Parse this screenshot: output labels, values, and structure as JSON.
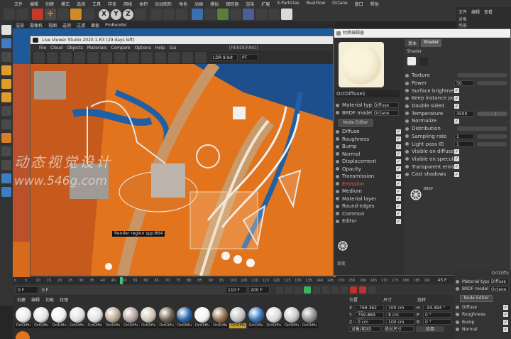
{
  "menubar": {
    "items": [
      "文件",
      "编辑",
      "创建",
      "模式",
      "选择",
      "工具",
      "样条",
      "网格",
      "体积",
      "运动图形",
      "角色",
      "动画",
      "模拟",
      "跟踪器",
      "渲染",
      "扩展",
      "X-Particles",
      "RealFlow",
      "Octane",
      "窗口",
      "帮助"
    ]
  },
  "tabs": {
    "items": [
      "渲染",
      "摄像机",
      "视图",
      "选项",
      "过滤",
      "面板",
      "ProRender"
    ]
  },
  "axes": {
    "x": "X",
    "y": "Y",
    "z": "Z"
  },
  "right_menu": {
    "items": [
      "文件",
      "编辑",
      "查看"
    ]
  },
  "live_viewer": {
    "title": "Live Viewer Studio 2020.1-R3 (29 days left)",
    "menu": [
      "File",
      "Cloud",
      "Objects",
      "Materials",
      "Compare",
      "Options",
      "Help",
      "Gui"
    ],
    "status": "[RENDERING]",
    "ldr": "LDR 8-bit",
    "pt": "PT",
    "render_region": "Render region spp:864"
  },
  "watermark": {
    "cn": "动态视觉设计",
    "url": "www.546g.com"
  },
  "material_editor": {
    "title": "材质编辑器",
    "material_name": "OctDiffuse1",
    "tabs": [
      "基本",
      "Shader"
    ],
    "section": "Shader",
    "left_rows": [
      {
        "label": "Material type",
        "value": "Diffuse"
      },
      {
        "label": "BRDF model",
        "value": "Octane"
      }
    ],
    "node_editor": "Node Editor",
    "channels": [
      "Diffuse",
      "Roughness",
      "Bump",
      "Normal",
      "Displacement",
      "Opacity",
      "Transmission",
      "Emission",
      "Medium",
      "Material layer",
      "Round edges",
      "Common",
      "Editor"
    ],
    "active_channel": "Emission",
    "right_rows": [
      {
        "label": "Texture",
        "value": ""
      },
      {
        "label": "Power",
        "value": "50."
      },
      {
        "label": "Surface brightness",
        "value": ""
      },
      {
        "label": "Keep instance power",
        "value": ""
      },
      {
        "label": "Double sided",
        "value": ""
      },
      {
        "label": "Temperature",
        "value": "3500"
      },
      {
        "label": "Normalize",
        "value": ""
      },
      {
        "label": "Distribution",
        "value": ""
      },
      {
        "label": "Sampling rate",
        "value": "1"
      },
      {
        "label": "Light pass ID",
        "value": "1"
      },
      {
        "label": "Visible on diffuse",
        "value": ""
      },
      {
        "label": "Visible on specular",
        "value": ""
      },
      {
        "label": "Transparent emission",
        "value": ""
      },
      {
        "label": "Cast shadows",
        "value": ""
      }
    ],
    "logo_label": "BBSP",
    "footer": "渐变"
  },
  "timeline": {
    "ticks": [
      "0",
      "5",
      "10",
      "15",
      "20",
      "25",
      "30",
      "35",
      "40",
      "45",
      "50",
      "55",
      "60",
      "65",
      "70",
      "75",
      "80",
      "85",
      "90",
      "95",
      "100",
      "105",
      "110",
      "115",
      "120",
      "125",
      "130",
      "135",
      "140",
      "145",
      "150",
      "155",
      "160",
      "165",
      "170",
      "175",
      "180",
      "185",
      "190"
    ],
    "current": "0 F",
    "start": "0 F",
    "end": "110 F",
    "end2": "200 F",
    "frame_right": "45 F"
  },
  "material_manager": {
    "menu": [
      "创建",
      "编辑",
      "功能",
      "纹理"
    ],
    "labels": [
      "OctDiffu",
      "OctDiffu",
      "OctDiffu",
      "OctDiffu",
      "OctDiffu",
      "OctDiffu",
      "OctDiffu",
      "OctDiffu",
      "OctDiffu",
      "OctDiffu",
      "OctDiffu",
      "OctDiffu",
      "OctDiffu",
      "OctDiffu",
      "OctDiffu",
      "OctDiffu",
      "OctDiffu",
      "OctDiffu",
      "OctDiffu"
    ],
    "colors": [
      "#e9e9e9",
      "#e4e4e4",
      "#efefef",
      "#dedede",
      "#e0e0e0",
      "#b9a48d",
      "#b59f9f",
      "#cfc3b1",
      "#6b5a4a",
      "#1f5fa8",
      "#f2f2f2",
      "#8b6a44",
      "#bdbdbd",
      "#2f6fb5",
      "#d9d9d9",
      "#c4c4c4",
      "#8a8a8a"
    ]
  },
  "coords": {
    "headers": [
      "位置",
      "尺寸",
      "旋转"
    ],
    "rows": [
      {
        "axis": "X",
        "pos": "-769.362 cm",
        "size": "100 cm",
        "rot_axis": "H",
        "rot": "-34.494 °"
      },
      {
        "axis": "Y",
        "pos": "759.869 cm",
        "size": "8 cm",
        "rot_axis": "P",
        "rot": "0 °"
      },
      {
        "axis": "Z",
        "pos": "0 cm",
        "size": "100 cm",
        "rot_axis": "B",
        "rot": "0 °"
      }
    ],
    "mode": "对象(相对)",
    "mode2": "绝对尺寸",
    "apply": "应用"
  },
  "bottom_right": {
    "title": "OctDiffu",
    "material_type": "Material type",
    "material_type_value": "Diffuse",
    "brdf": "BRDF model",
    "brdf_value": "Octane",
    "node_editor": "Node Editor",
    "channels": [
      "Diffuse",
      "Roughness",
      "Bump",
      "Normal"
    ],
    "header_tabs": [
      "基本",
      "着色"
    ]
  },
  "right_panel": {
    "labels": [
      "对象",
      "场景",
      "Octane"
    ]
  }
}
